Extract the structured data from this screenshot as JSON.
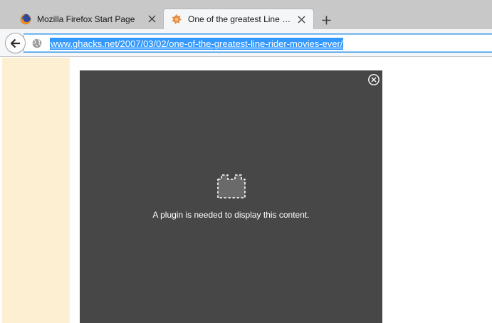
{
  "tabs": [
    {
      "label": "Mozilla Firefox Start Page",
      "favicon": "firefox-logo-icon",
      "active": false
    },
    {
      "label": "One of the greatest Line Ri...",
      "favicon": "ghacks-logo-icon",
      "active": true
    }
  ],
  "toolbar": {
    "url": "www.ghacks.net/2007/03/02/one-of-the-greatest-line-rider-movies-ever/"
  },
  "plugin": {
    "message": "A plugin is needed to display this content."
  },
  "colors": {
    "accent": "#3399ff",
    "plugin_bg": "#474747",
    "sidebar_bg": "#fdefd2"
  }
}
